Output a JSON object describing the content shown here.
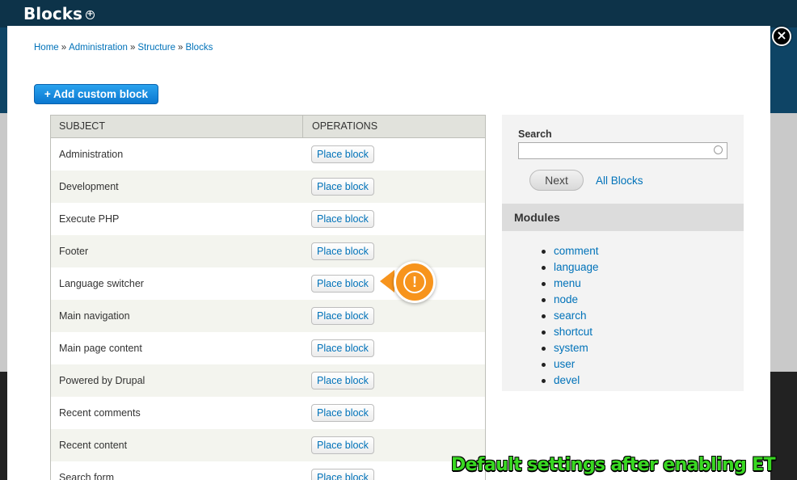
{
  "background": {
    "page_title": "Blocks",
    "add_icon": "plus-circle-icon"
  },
  "modal": {
    "close_icon": "×",
    "breadcrumb": [
      {
        "label": "Home"
      },
      {
        "label": "Administration"
      },
      {
        "label": "Structure"
      },
      {
        "label": "Blocks"
      }
    ],
    "breadcrumb_separator": "»",
    "add_button_label": "+ Add custom block",
    "table": {
      "headers": {
        "subject": "SUBJECT",
        "operations": "OPERATIONS"
      },
      "rows": [
        {
          "subject": "Administration",
          "action": "Place block"
        },
        {
          "subject": "Development",
          "action": "Place block"
        },
        {
          "subject": "Execute PHP",
          "action": "Place block"
        },
        {
          "subject": "Footer",
          "action": "Place block"
        },
        {
          "subject": "Language switcher",
          "action": "Place block"
        },
        {
          "subject": "Main navigation",
          "action": "Place block"
        },
        {
          "subject": "Main page content",
          "action": "Place block"
        },
        {
          "subject": "Powered by Drupal",
          "action": "Place block"
        },
        {
          "subject": "Recent comments",
          "action": "Place block"
        },
        {
          "subject": "Recent content",
          "action": "Place block"
        },
        {
          "subject": "Search form",
          "action": "Place block"
        }
      ]
    },
    "warning": {
      "glyph": "!",
      "icon": "warning-icon",
      "color": "#f7941d"
    },
    "sidebar": {
      "search_label": "Search",
      "search_value": "",
      "next_label": "Next",
      "all_blocks_label": "All Blocks",
      "modules_title": "Modules",
      "modules": [
        "comment",
        "language",
        "menu",
        "node",
        "search",
        "shortcut",
        "system",
        "user",
        "devel"
      ]
    }
  },
  "caption": "Default settings after enabling ET",
  "colors": {
    "link": "#0072b9",
    "primary_button": "#1a8de0",
    "caption": "#39d822"
  }
}
